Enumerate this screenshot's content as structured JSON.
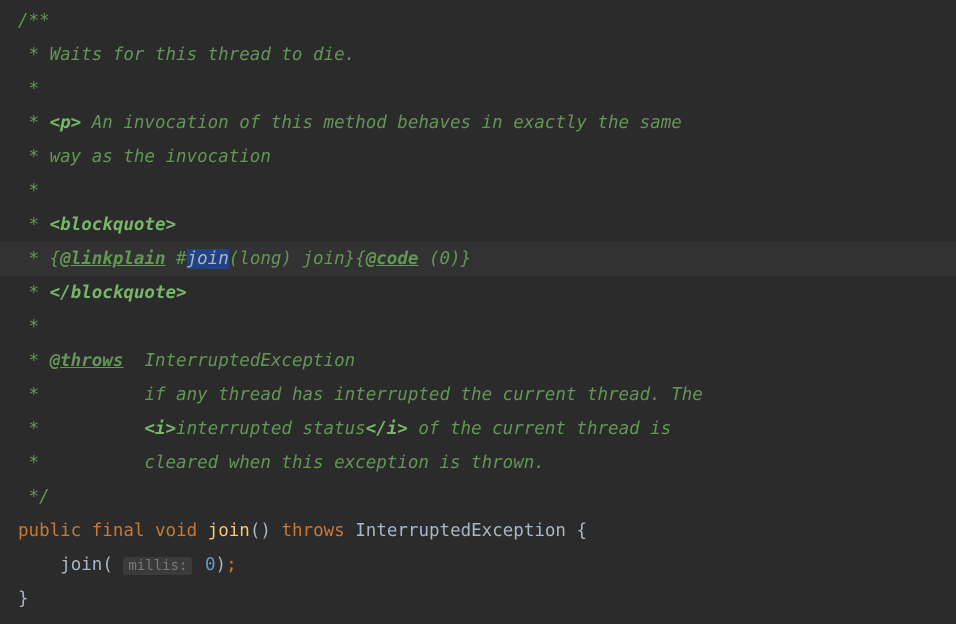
{
  "code": {
    "l1": "/**",
    "l2_prefix": " * ",
    "l2_text": "Waits for this thread to die.",
    "l3": " *",
    "l4_prefix": " * ",
    "l4_tag": "<p>",
    "l4_text": " An invocation of this method behaves in exactly the same",
    "l5_prefix": " * ",
    "l5_text": "way as the invocation",
    "l6": " *",
    "l7_prefix": " * ",
    "l7_tag": "<blockquote>",
    "l8_prefix": " * ",
    "l8_brace1": "{",
    "l8_linkplain": "@linkplain",
    "l8_hash": " #",
    "l8_join": "join",
    "l8_after_join": "(long) join",
    "l8_brace2": "}{",
    "l8_code": "@code",
    "l8_code_arg": " (0)",
    "l8_brace3": "}",
    "l9_prefix": " * ",
    "l9_tag": "</blockquote>",
    "l10": " *",
    "l11_prefix": " * ",
    "l11_throws": "@throws",
    "l11_text": "  InterruptedException",
    "l12_prefix": " *          ",
    "l12_text": "if any thread has interrupted the current thread. The",
    "l13_prefix": " *          ",
    "l13_i1": "<i>",
    "l13_mid": "interrupted status",
    "l13_i2": "</i>",
    "l13_text": " of the current thread is",
    "l14_prefix": " *          ",
    "l14_text": "cleared when this exception is thrown.",
    "l15": " */",
    "l16_public": "public",
    "l16_final": "final",
    "l16_void": "void",
    "l16_method": "join",
    "l16_parens": "()",
    "l16_throws": "throws",
    "l16_exc": "InterruptedException {",
    "l17_indent": "    ",
    "l17_method": "join",
    "l17_open": "(",
    "l17_hint": "millis:",
    "l17_num": "0",
    "l17_close": ")",
    "l17_semi": ";",
    "l18": "}"
  }
}
